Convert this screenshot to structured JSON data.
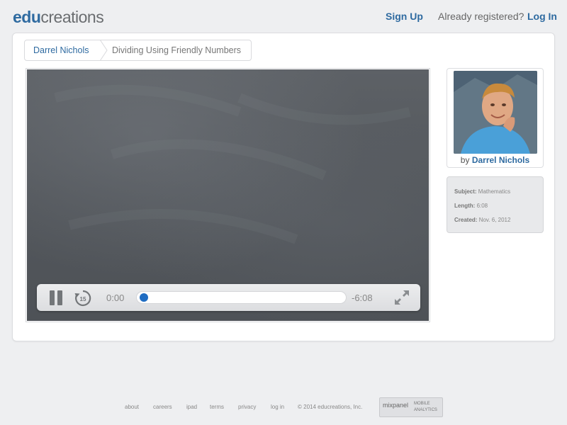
{
  "header": {
    "logo_edu": "edu",
    "logo_rest": "creations",
    "sign_up": "Sign Up",
    "already_registered": "Already registered?",
    "log_in": "Log In"
  },
  "breadcrumb": {
    "author": "Darrel Nichols",
    "title": "Dividing Using Friendly Numbers"
  },
  "player": {
    "elapsed": "0:00",
    "remaining": "-6:08",
    "replay_seconds": "15",
    "progress_fraction": 0.0
  },
  "author": {
    "by": "by",
    "name": "Darrel Nichols"
  },
  "meta": {
    "subject_label": "Subject:",
    "subject_value": "Mathematics",
    "length_label": "Length:",
    "length_value": "6:08",
    "created_label": "Created:",
    "created_value": "Nov. 6, 2012"
  },
  "footer": {
    "links": [
      "about",
      "careers",
      "ipad",
      "terms",
      "privacy",
      "log in"
    ],
    "copyright": "© 2014 educreations, Inc.",
    "mixpanel": "mixpanel",
    "mixpanel_sub1": "MOBILE",
    "mixpanel_sub2": "ANALYTICS"
  },
  "icons": {
    "pause": "pause-icon",
    "replay": "replay-15-icon",
    "fullscreen": "expand-icon",
    "breadcrumb_sep": "chevron-right-icon"
  },
  "colors": {
    "brand_blue": "#2e6aa0",
    "progress_blue": "#1f6cc2",
    "chalkboard": "#55595e"
  }
}
